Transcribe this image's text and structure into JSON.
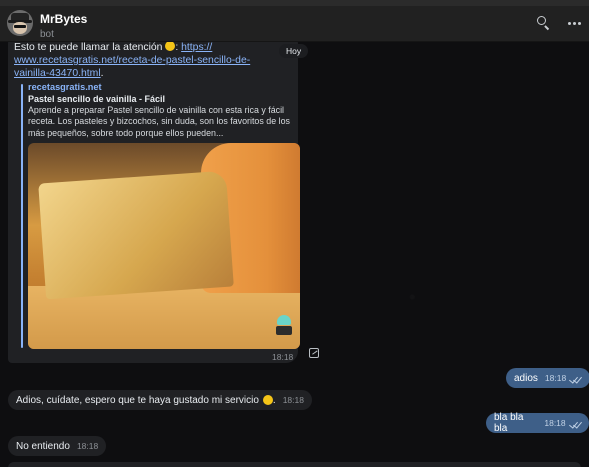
{
  "header": {
    "bot_name": "MrBytes",
    "bot_status": "bot",
    "search_icon": "search-icon",
    "more_icon": "more-vertical-icon"
  },
  "date_separator": "Hoy",
  "messages": {
    "recipe": {
      "text_prefix": "Esto te puede llamar la atención",
      "emoji": "smiling-face",
      "link": "https://www.recetasgratis.net/receta-de-pastel-sencillo-de-vainilla-43470.html",
      "link_line1": "https://",
      "link_line2": "www.recetasgratis.net/receta-de-pastel-sencillo-de-",
      "link_line3": "vainilla-43470.html",
      "preview_site": "recetasgratis.net",
      "preview_title": "Pastel sencillo de vainilla - Fácil",
      "preview_description": "Aprende a preparar Pastel sencillo de vainilla con esta rica y fácil receta. Los pasteles y bizcochos, sin duda, son los favoritos de los más pequeños, sobre todo porque ellos pueden...",
      "time": "18:18"
    },
    "out_adios": {
      "text": "adios",
      "time": "18:18"
    },
    "in_adios": {
      "text": "Adios, cuídate, espero que te haya gustado mi servicio",
      "time": "18:18"
    },
    "out_bla": {
      "text": "bla bla bla",
      "time": "18:18"
    },
    "in_noent": {
      "text": "No entiendo",
      "time": "18:18"
    }
  },
  "colors": {
    "accent_link": "#8ab4f8",
    "outgoing_bubble": "#3e5f88",
    "incoming_bubble": "#202124"
  }
}
